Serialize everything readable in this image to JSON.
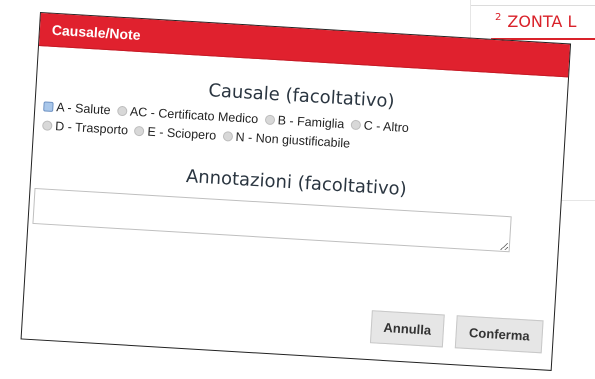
{
  "background": {
    "heading_num": "2",
    "heading_text": "ZONTA L",
    "accent_color": "#d9222a"
  },
  "dialog": {
    "title": "Causale/Note",
    "header_color": "#e0212e",
    "causale_title": "Causale (facoltativo)",
    "options": [
      {
        "label": "A - Salute",
        "checked": true
      },
      {
        "label": "AC - Certificato Medico",
        "checked": false
      },
      {
        "label": "B - Famiglia",
        "checked": false
      },
      {
        "label": "C - Altro",
        "checked": false
      },
      {
        "label": "D - Trasporto",
        "checked": false
      },
      {
        "label": "E - Sciopero",
        "checked": false
      },
      {
        "label": "N - Non giustificabile",
        "checked": false
      }
    ],
    "annotazioni_title": "Annotazioni (facoltativo)",
    "annotazioni_value": "",
    "cancel_label": "Annulla",
    "confirm_label": "Conferma"
  }
}
